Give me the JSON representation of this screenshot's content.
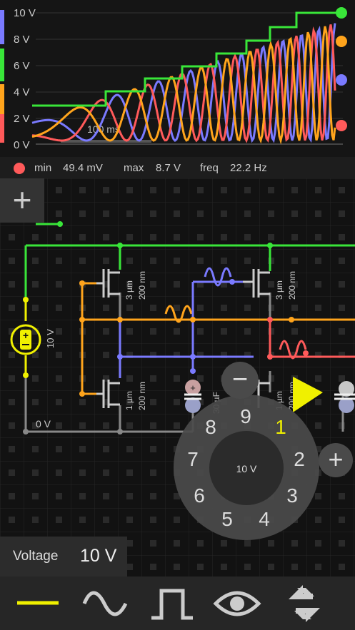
{
  "scope": {
    "y_ticks": [
      "10 V",
      "8 V",
      "6 V",
      "4 V",
      "2 V",
      "0 V"
    ],
    "time_label": "100 ms",
    "stats": {
      "min_label": "min",
      "min_value": "49.4 mV",
      "max_label": "max",
      "max_value": "8.7 V",
      "freq_label": "freq",
      "freq_value": "22.2 Hz"
    }
  },
  "circuit": {
    "source_label": "10 V",
    "ground_label": "0 V",
    "cap_label": "30 µF",
    "transistors": [
      {
        "width": "3 µm",
        "length": "200 nm"
      },
      {
        "width": "3 µm",
        "length": "200 nm"
      },
      {
        "width": "1 µm",
        "length": "200 nm"
      },
      {
        "width": "1 µm",
        "length": "200 nm"
      }
    ]
  },
  "dial": {
    "center_value": "10 V",
    "digits": [
      "9",
      "1",
      "2",
      "3",
      "4",
      "5",
      "6",
      "7",
      "8"
    ],
    "minus_label": "−",
    "plus_label": "+"
  },
  "add_button_label": "+",
  "voltage_panel": {
    "label": "Voltage",
    "value": "10 V"
  },
  "toolbar": {
    "icons": [
      "dc-line-icon",
      "sine-wave-icon",
      "square-wave-icon",
      "eye-icon",
      "cycle-arrows-icon"
    ]
  },
  "colors": {
    "green": "#39e639",
    "blue": "#7a7aff",
    "orange": "#ffa41c",
    "red": "#ff5a5a",
    "yellow": "#f0f000"
  }
}
